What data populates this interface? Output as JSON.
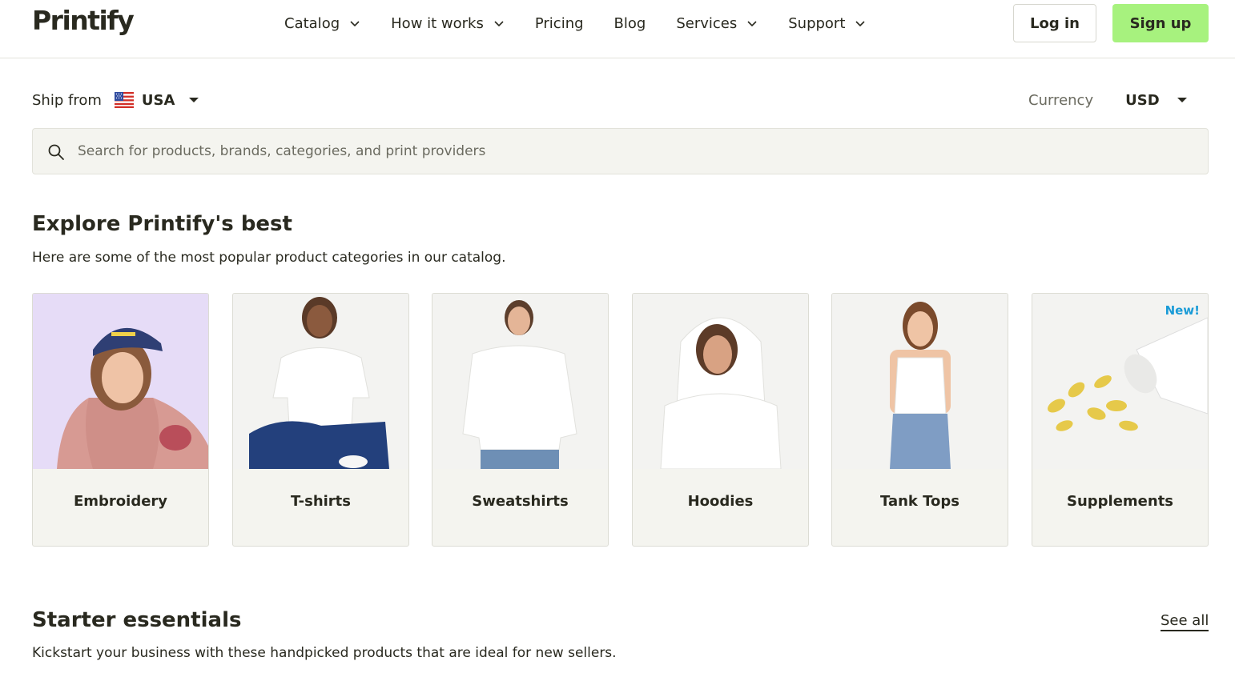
{
  "header": {
    "logo": "Printify",
    "nav": [
      {
        "label": "Catalog",
        "has_dropdown": true
      },
      {
        "label": "How it works",
        "has_dropdown": true
      },
      {
        "label": "Pricing",
        "has_dropdown": false
      },
      {
        "label": "Blog",
        "has_dropdown": false
      },
      {
        "label": "Services",
        "has_dropdown": true
      },
      {
        "label": "Support",
        "has_dropdown": true
      }
    ],
    "login_label": "Log in",
    "signup_label": "Sign up"
  },
  "ship_from": {
    "label": "Ship from",
    "value": "USA",
    "flag_icon": "us-flag-icon"
  },
  "currency": {
    "label": "Currency",
    "value": "USD"
  },
  "search": {
    "placeholder": "Search for products, brands, categories, and print providers",
    "value": ""
  },
  "explore": {
    "title": "Explore Printify's best",
    "subtitle": "Here are some of the most popular product categories in our catalog.",
    "categories": [
      {
        "label": "Embroidery",
        "badge": ""
      },
      {
        "label": "T-shirts",
        "badge": ""
      },
      {
        "label": "Sweatshirts",
        "badge": ""
      },
      {
        "label": "Hoodies",
        "badge": ""
      },
      {
        "label": "Tank Tops",
        "badge": ""
      },
      {
        "label": "Supplements",
        "badge": "New!"
      }
    ]
  },
  "starter": {
    "title": "Starter essentials",
    "subtitle": "Kickstart your business with these handpicked products that are ideal for new sellers.",
    "see_all_label": "See all"
  },
  "colors": {
    "accent_green": "#a7f27e",
    "text_dark": "#29291f",
    "new_badge_blue": "#1a9bd7",
    "card_bg": "#f4f4ef"
  }
}
